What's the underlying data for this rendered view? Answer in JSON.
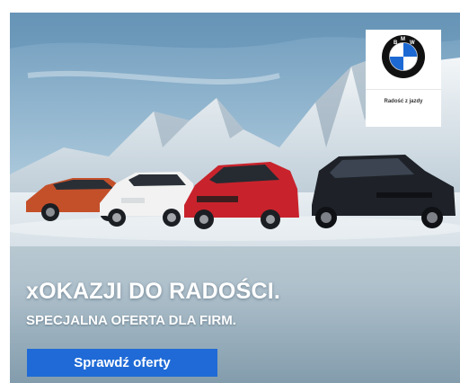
{
  "brand": {
    "name": "BMW",
    "tagline": "Radość z jazdy"
  },
  "headline": "xOKAZJI DO RADOŚCI.",
  "subheadline": "SPECJALNA OFERTA DLA FIRM.",
  "cta": {
    "label": "Sprawdź oferty",
    "color": "#1f6ad6"
  },
  "cars": [
    {
      "model": "BMW 2 Series Active Tourer",
      "color": "#c4502a"
    },
    {
      "model": "BMW X1",
      "color": "#f2f2f2"
    },
    {
      "model": "BMW X4",
      "color": "#c8232c"
    },
    {
      "model": "BMW X5",
      "color": "#1e2228"
    }
  ],
  "colors": {
    "sky": "#9fc3d9",
    "snow": "#e9eef2",
    "logo_blue": "#1c69d4"
  }
}
